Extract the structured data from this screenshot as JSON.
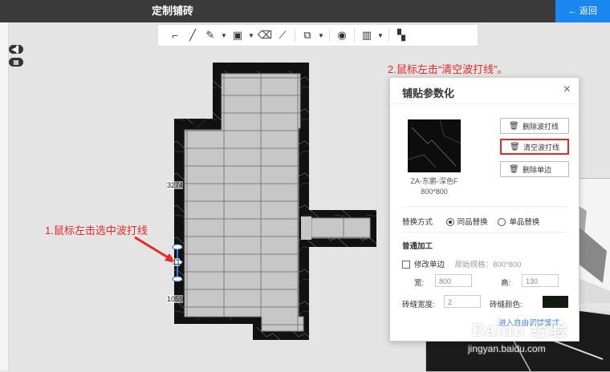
{
  "topbar": {
    "title": "定制铺砖",
    "back_label": "← 返回"
  },
  "sidebar": {
    "btn1": "◀▌",
    "btn2": "▦"
  },
  "toolbar": {
    "tools": [
      "corner-line-icon",
      "line-icon",
      "pen-icon",
      "frame-icon",
      "eraser-icon",
      "ruler-icon",
      "copy-icon",
      "eye-icon",
      "map-icon",
      "layout-icon"
    ]
  },
  "canvas": {
    "dimensions": [
      "3274",
      "11",
      "1059"
    ],
    "annotation_1": "1.鼠标左击选中波打线",
    "annotation_2": "2.鼠标左击“清空波打线”。"
  },
  "panel": {
    "title": "铺贴参数化",
    "close": "×",
    "tile_name": "ZA-东鹏-深色F",
    "tile_size": "800*800",
    "buttons": {
      "delete_border": "删除波打线",
      "clear_border": "清空波打线",
      "delete_edge": "删除单边"
    },
    "replace_label": "替换方式",
    "replace_options": [
      "同品替换",
      "单品替换"
    ],
    "processing_title": "普通加工",
    "modify_edge": "修改单边",
    "original_spec": "原始规格：800*800",
    "width_label": "宽:",
    "width_value": "800",
    "height_label": "高:",
    "height_value": "130",
    "gap_label": "砖缝宽度:",
    "gap_value": "2",
    "gap_color_label": "砖缝颜色:",
    "link_text": "进入自由调铺模式",
    "colors": {
      "gap_color": "#131a14",
      "accent": "#e52a2a"
    }
  },
  "watermark": {
    "line1": "Baidu 经验",
    "line2": "jingyan.baidu.com"
  }
}
